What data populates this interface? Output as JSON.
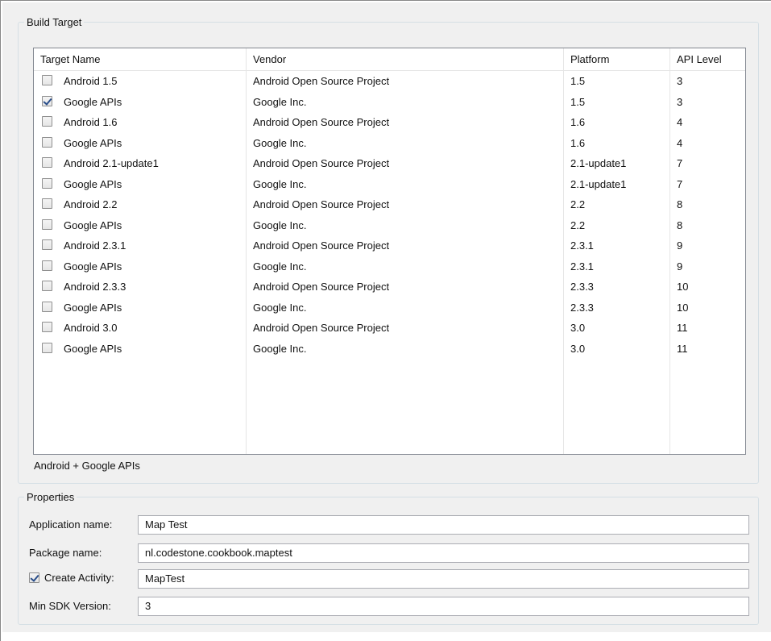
{
  "build_target": {
    "legend": "Build Target",
    "columns": [
      "Target Name",
      "Vendor",
      "Platform",
      "API Level"
    ],
    "rows": [
      {
        "checked": false,
        "name": "Android 1.5",
        "vendor": "Android Open Source Project",
        "platform": "1.5",
        "api": "3"
      },
      {
        "checked": true,
        "name": "Google APIs",
        "vendor": "Google Inc.",
        "platform": "1.5",
        "api": "3"
      },
      {
        "checked": false,
        "name": "Android 1.6",
        "vendor": "Android Open Source Project",
        "platform": "1.6",
        "api": "4"
      },
      {
        "checked": false,
        "name": "Google APIs",
        "vendor": "Google Inc.",
        "platform": "1.6",
        "api": "4"
      },
      {
        "checked": false,
        "name": "Android 2.1-update1",
        "vendor": "Android Open Source Project",
        "platform": "2.1-update1",
        "api": "7"
      },
      {
        "checked": false,
        "name": "Google APIs",
        "vendor": "Google Inc.",
        "platform": "2.1-update1",
        "api": "7"
      },
      {
        "checked": false,
        "name": "Android 2.2",
        "vendor": "Android Open Source Project",
        "platform": "2.2",
        "api": "8"
      },
      {
        "checked": false,
        "name": "Google APIs",
        "vendor": "Google Inc.",
        "platform": "2.2",
        "api": "8"
      },
      {
        "checked": false,
        "name": "Android 2.3.1",
        "vendor": "Android Open Source Project",
        "platform": "2.3.1",
        "api": "9"
      },
      {
        "checked": false,
        "name": "Google APIs",
        "vendor": "Google Inc.",
        "platform": "2.3.1",
        "api": "9"
      },
      {
        "checked": false,
        "name": "Android 2.3.3",
        "vendor": "Android Open Source Project",
        "platform": "2.3.3",
        "api": "10"
      },
      {
        "checked": false,
        "name": "Google APIs",
        "vendor": "Google Inc.",
        "platform": "2.3.3",
        "api": "10"
      },
      {
        "checked": false,
        "name": "Android 3.0",
        "vendor": "Android Open Source Project",
        "platform": "3.0",
        "api": "11"
      },
      {
        "checked": false,
        "name": "Google APIs",
        "vendor": "Google Inc.",
        "platform": "3.0",
        "api": "11"
      }
    ],
    "selection_description": "Android + Google APIs"
  },
  "properties": {
    "legend": "Properties",
    "application_name_label": "Application name:",
    "application_name_value": "Map Test",
    "package_name_label": "Package name:",
    "package_name_value": "nl.codestone.cookbook.maptest",
    "create_activity_label": "Create Activity:",
    "create_activity_checked": true,
    "create_activity_value": "MapTest",
    "min_sdk_label": "Min SDK Version:",
    "min_sdk_value": "3"
  }
}
